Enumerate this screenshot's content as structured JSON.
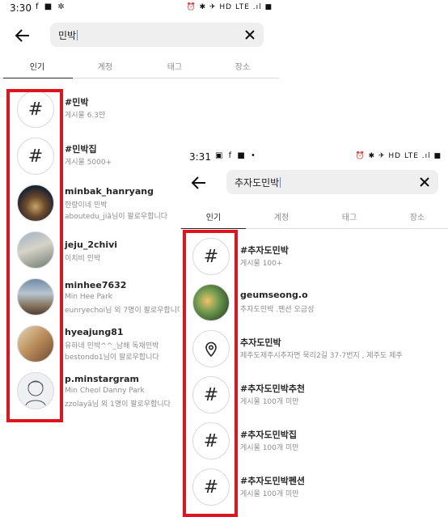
{
  "screen1": {
    "status": {
      "time": "3:30",
      "left_icons": "f ■ ✲",
      "right_icons": "⏰ ✱ ✈ HD LTE .ıl ■"
    },
    "search": {
      "query": "민박"
    },
    "tabs": [
      "인기",
      "계정",
      "태그",
      "장소"
    ],
    "results": [
      {
        "type": "hashtag",
        "title": "#민박",
        "sub": "게시물 6.3만",
        "sub2": ""
      },
      {
        "type": "hashtag",
        "title": "#민박집",
        "sub": "게시물 5000+",
        "sub2": ""
      },
      {
        "type": "account",
        "photo": "night",
        "title": "minbak_hanryang",
        "sub": "한량이네 민박",
        "sub2": "aboutedu_jiã님이 팔로우합니다"
      },
      {
        "type": "account",
        "photo": "house",
        "title": "jeju_2chivi",
        "sub": "이치비 민박",
        "sub2": ""
      },
      {
        "type": "account",
        "photo": "beach",
        "title": "minhee7632",
        "sub": "Min Hee Park",
        "sub2": "eunryechoi님 외 7명이 팔로우합니다"
      },
      {
        "type": "account",
        "photo": "room",
        "title": "hyeajung81",
        "sub": "유하네 민박^^_남해 독채민박",
        "sub2": "bestondo1님이 팔로우합니다"
      },
      {
        "type": "account",
        "photo": "sketch",
        "title": "p.minstargram",
        "sub": "Min Cheol Danny Park",
        "sub2": "zzolayã님 외 1명이 팔로우합니다"
      }
    ]
  },
  "screen2": {
    "status": {
      "time": "3:31",
      "left_icons": "▣ f ■ •",
      "right_icons": "⏰ ✱ ✈ HD LTE .ıl ■"
    },
    "search": {
      "query": "추자도민박"
    },
    "tabs": [
      "인기",
      "계정",
      "태그",
      "장소"
    ],
    "results": [
      {
        "type": "hashtag",
        "title": "#추자도민박",
        "sub": "게시물 100+"
      },
      {
        "type": "account",
        "photo": "food",
        "title": "geumseong.o",
        "sub": "추자도민박 .펜션 오금성"
      },
      {
        "type": "place",
        "title": "추자도민박",
        "sub": "제주도제주시추자면 묵리2길 37-7번지 , 제주도 제주"
      },
      {
        "type": "hashtag",
        "title": "#추자도민박추천",
        "sub": "게시물 100개 미만"
      },
      {
        "type": "hashtag",
        "title": "#추자도민박집",
        "sub": "게시물 100개 미만"
      },
      {
        "type": "hashtag",
        "title": "#추자도민박펜션",
        "sub": "게시물 100개 미만"
      }
    ]
  },
  "colors": {
    "highlight": "#e0141e",
    "caret": "#5a8dee",
    "muted": "#8e8e8e"
  }
}
